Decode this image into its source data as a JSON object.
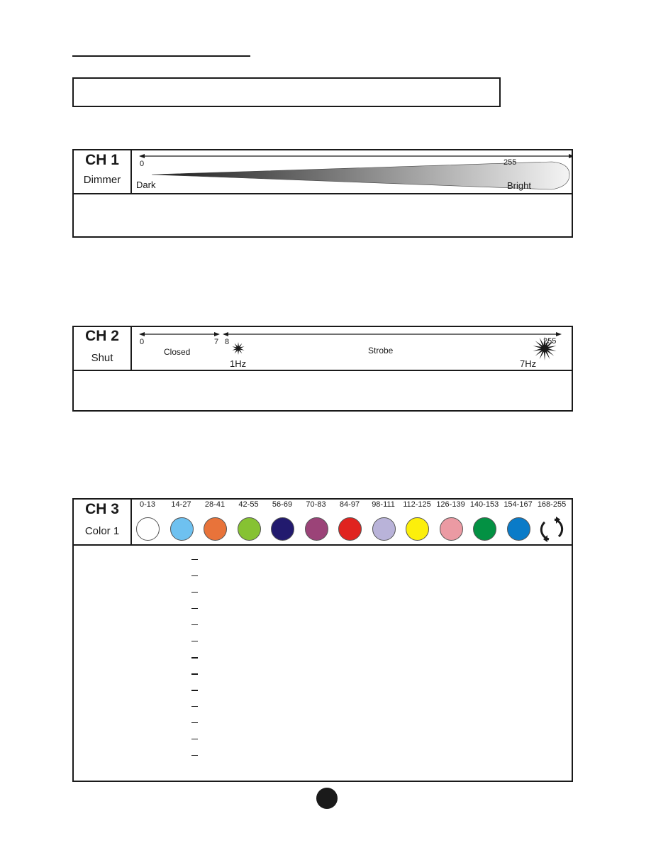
{
  "page": {
    "page_dot_label": ""
  },
  "channels": [
    {
      "id": "ch1",
      "number": "CH 1",
      "name": "Dimmer",
      "range_start": "0",
      "range_end": "255",
      "label_low": "Dark",
      "label_high": "Bright",
      "gradient": {
        "from": "#1a1a1a",
        "to": "#f4f4f4"
      }
    },
    {
      "id": "ch2",
      "number": "CH 2",
      "name": "Shut",
      "segments": [
        {
          "start": "0",
          "end": "7",
          "label": "Closed"
        },
        {
          "start": "8",
          "end": "255",
          "label": "Strobe",
          "low_freq": "1Hz",
          "high_freq": "7Hz"
        }
      ]
    },
    {
      "id": "ch3",
      "number": "CH 3",
      "name": "Color 1",
      "colors": [
        {
          "range": "0-13",
          "color": "#ffffff",
          "icon": "white-circle"
        },
        {
          "range": "14-27",
          "color": "#6EC1F0",
          "icon": "light-blue-circle"
        },
        {
          "range": "28-41",
          "color": "#E8733A",
          "icon": "orange-circle"
        },
        {
          "range": "42-55",
          "color": "#86C232",
          "icon": "green-circle"
        },
        {
          "range": "56-69",
          "color": "#221A6E",
          "icon": "dark-blue-circle"
        },
        {
          "range": "70-83",
          "color": "#9B4378",
          "icon": "magenta-circle"
        },
        {
          "range": "84-97",
          "color": "#E0231F",
          "icon": "red-circle"
        },
        {
          "range": "98-111",
          "color": "#B9B3D9",
          "icon": "lavender-circle"
        },
        {
          "range": "112-125",
          "color": "#FCEF0B",
          "icon": "yellow-circle"
        },
        {
          "range": "126-139",
          "color": "#EB9AA3",
          "icon": "pink-circle"
        },
        {
          "range": "140-153",
          "color": "#039143",
          "icon": "green-circle"
        },
        {
          "range": "154-167",
          "color": "#0A7BC8",
          "icon": "blue-circle"
        },
        {
          "range": "168-255",
          "color": "",
          "icon": "rotate-arrows-icon"
        }
      ],
      "list_rows": 13
    }
  ]
}
